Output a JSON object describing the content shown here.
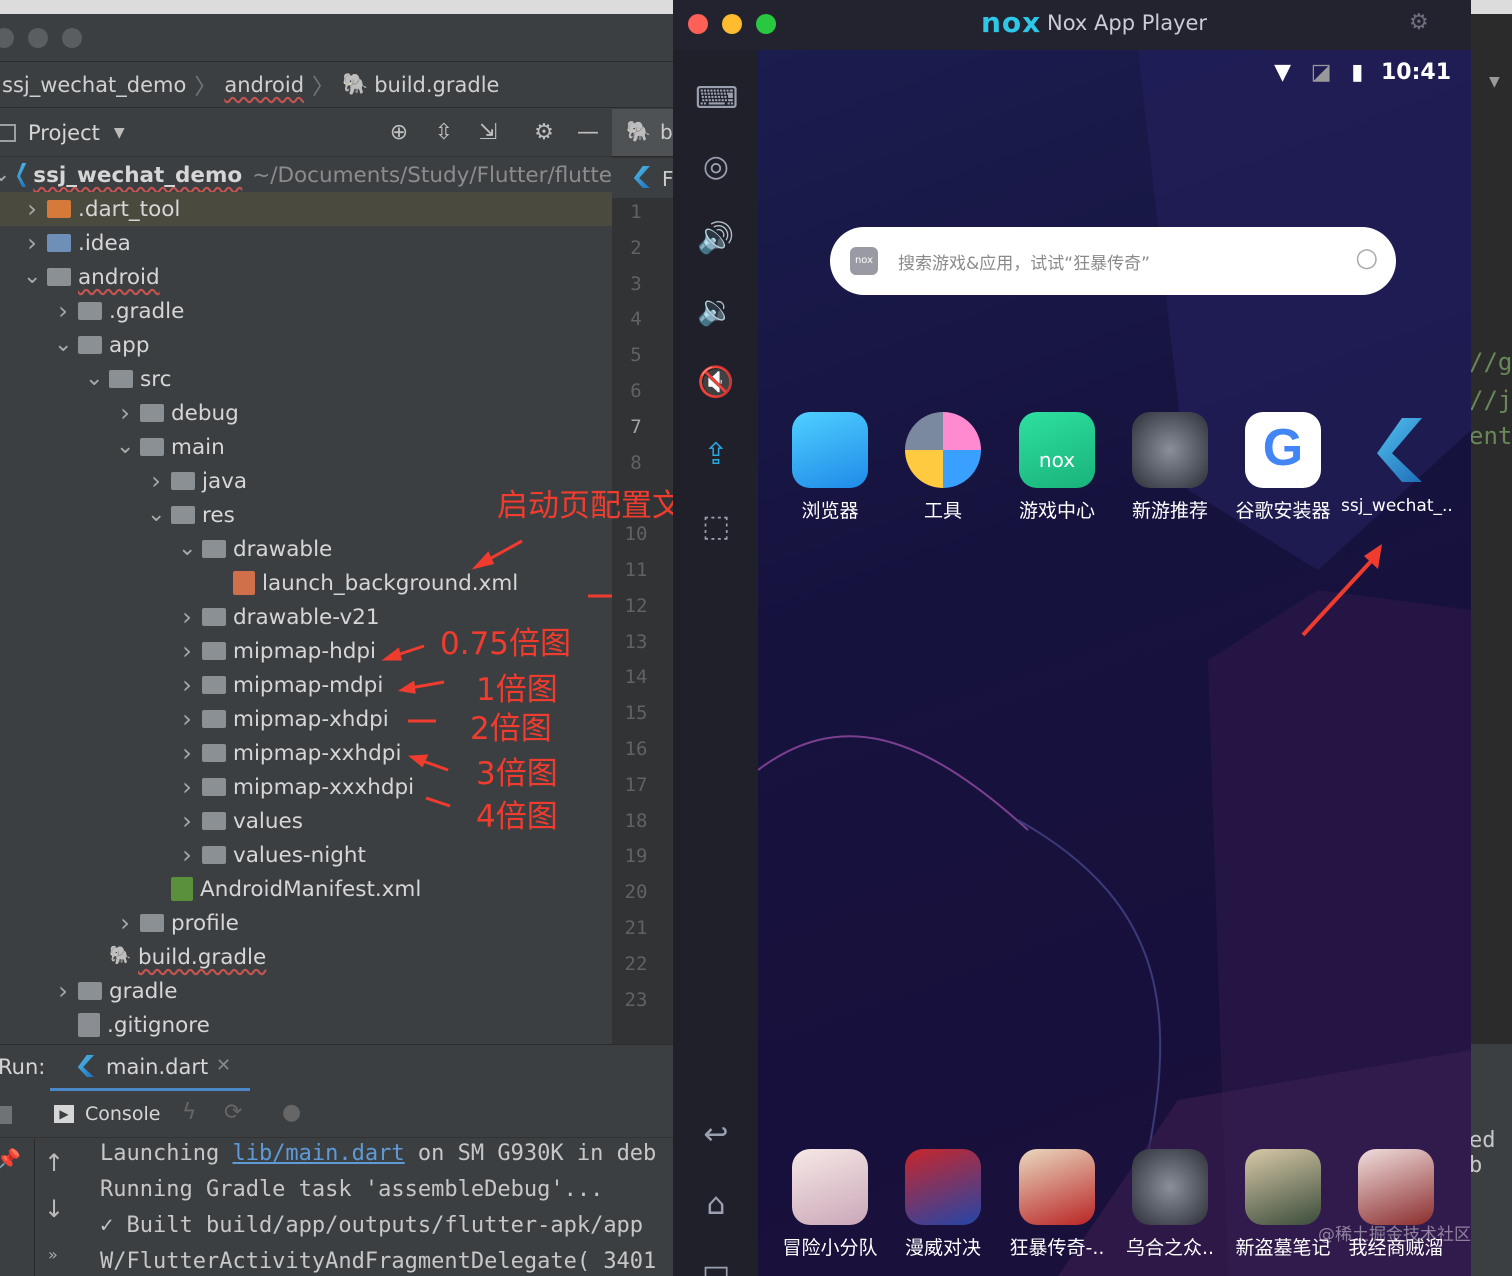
{
  "ide": {
    "breadcrumb": [
      "ssj_wechat_demo",
      "android",
      "build.gradle"
    ],
    "project_label": "Project",
    "editor_tab": "b",
    "editor_tab2": "F",
    "tree": [
      {
        "label": "ssj_wechat_demo",
        "path": "~/Documents/Study/Flutter/flutte",
        "icon": "flutter-icon"
      },
      {
        "label": ".dart_tool",
        "icon": "folder-icon"
      },
      {
        "label": ".idea",
        "icon": "folder-icon"
      },
      {
        "label": "android",
        "icon": "folder-icon"
      },
      {
        "label": ".gradle",
        "icon": "folder-icon"
      },
      {
        "label": "app",
        "icon": "folder-icon"
      },
      {
        "label": "src",
        "icon": "folder-icon"
      },
      {
        "label": "debug",
        "icon": "folder-icon"
      },
      {
        "label": "main",
        "icon": "folder-icon"
      },
      {
        "label": "java",
        "icon": "folder-icon"
      },
      {
        "label": "res",
        "icon": "folder-icon"
      },
      {
        "label": "drawable",
        "icon": "folder-icon"
      },
      {
        "label": "launch_background.xml",
        "icon": "xml-file-icon"
      },
      {
        "label": "drawable-v21",
        "icon": "folder-icon"
      },
      {
        "label": "mipmap-hdpi",
        "icon": "folder-icon"
      },
      {
        "label": "mipmap-mdpi",
        "icon": "folder-icon"
      },
      {
        "label": "mipmap-xhdpi",
        "icon": "folder-icon"
      },
      {
        "label": "mipmap-xxhdpi",
        "icon": "folder-icon"
      },
      {
        "label": "mipmap-xxxhdpi",
        "icon": "folder-icon"
      },
      {
        "label": "values",
        "icon": "folder-icon"
      },
      {
        "label": "values-night",
        "icon": "folder-icon"
      },
      {
        "label": "AndroidManifest.xml",
        "icon": "manifest-file-icon"
      },
      {
        "label": "profile",
        "icon": "folder-icon"
      },
      {
        "label": "build.gradle",
        "icon": "gradle-icon"
      },
      {
        "label": "gradle",
        "icon": "folder-icon"
      },
      {
        "label": ".gitignore",
        "icon": "gitignore-file-icon"
      }
    ],
    "gutter": [
      "1",
      "2",
      "3",
      "4",
      "5",
      "6",
      "7",
      "8",
      "",
      "10",
      "11",
      "12",
      "13",
      "14",
      "15",
      "16",
      "17",
      "18",
      "19",
      "20",
      "21",
      "22",
      "23"
    ],
    "run": {
      "label": "Run:",
      "tab": "main.dart",
      "console_tab": "Console",
      "lines": [
        {
          "pre": "Launching ",
          "link": "lib/main.dart",
          "post": " on SM G930K in deb"
        },
        {
          "pre": "Running Gradle task 'assembleDebug'...",
          "link": "",
          "post": ""
        },
        {
          "pre": "✓  Built build/app/outputs/flutter-apk/app",
          "link": "",
          "post": ""
        },
        {
          "pre": "W/FlutterActivityAndFragmentDelegate( 3401",
          "link": "",
          "post": ""
        }
      ]
    }
  },
  "annotations": {
    "launch_config": "启动页配置文件",
    "hdpi": "0.75倍图",
    "mdpi": "1倍图",
    "xhdpi": "2倍图",
    "xxhdpi": "3倍图",
    "xxxhdpi": "4倍图",
    "color": "#f03c2e"
  },
  "nox": {
    "title": "Nox App Player",
    "logo": "nox",
    "time": "10:41",
    "search_placeholder": "搜索游戏&应用，试试“狂暴传奇”",
    "apps_top": [
      "浏览器",
      "工具",
      "游戏中心",
      "新游推荐",
      "谷歌安装器",
      "ssj_wechat_..."
    ],
    "apps_bottom": [
      "冒险小分队",
      "漫威对决",
      "狂暴传奇-..",
      "乌合之众..",
      "新盗墓笔记",
      "我经商贼溜"
    ],
    "watermark": "@稀土掘金技术社区"
  },
  "right_sliver": {
    "lines": [
      "//gc",
      "//jc",
      "ent/",
      "ed b"
    ]
  }
}
